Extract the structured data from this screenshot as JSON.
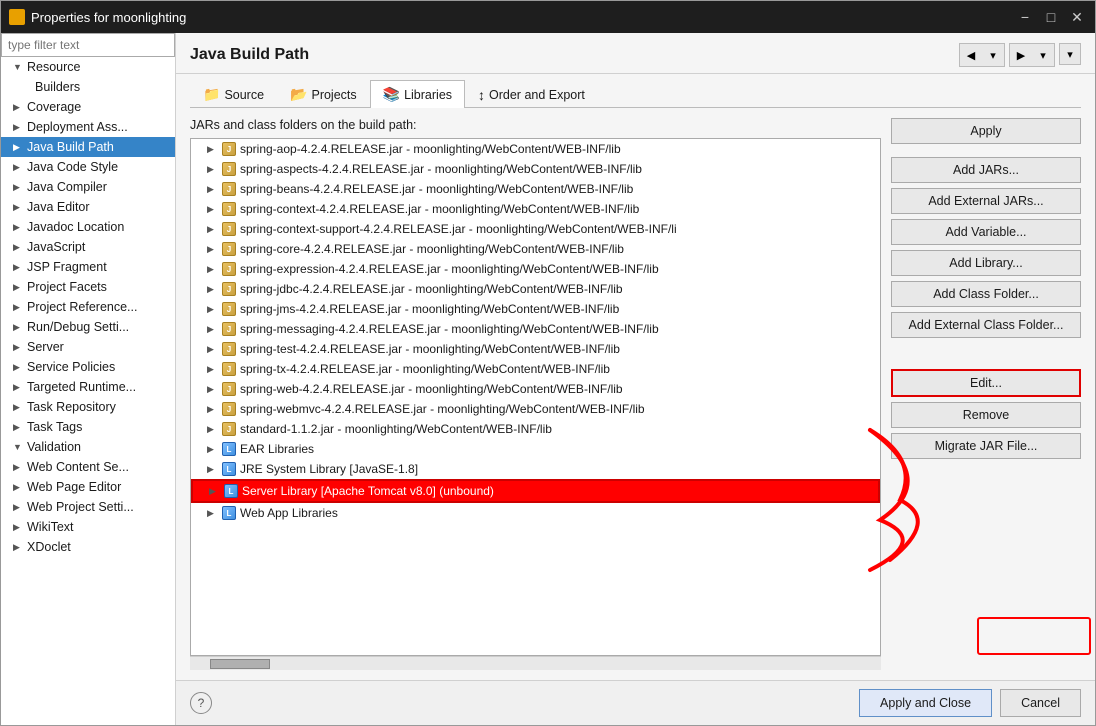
{
  "window": {
    "title": "Properties for moonlighting",
    "icon": "eclipse-icon"
  },
  "titlebar_buttons": {
    "minimize": "−",
    "maximize": "□",
    "close": "✕"
  },
  "filter": {
    "placeholder": "type filter text"
  },
  "sidebar": {
    "items": [
      {
        "label": "Resource",
        "expanded": true,
        "indent": 1,
        "selected": false
      },
      {
        "label": "Builders",
        "expanded": false,
        "indent": 2,
        "selected": false
      },
      {
        "label": "Coverage",
        "expanded": false,
        "indent": 1,
        "selected": false
      },
      {
        "label": "Deployment Ass...",
        "expanded": false,
        "indent": 1,
        "selected": false
      },
      {
        "label": "Java Build Path",
        "expanded": false,
        "indent": 1,
        "selected": true
      },
      {
        "label": "Java Code Style",
        "expanded": false,
        "indent": 1,
        "selected": false
      },
      {
        "label": "Java Compiler",
        "expanded": false,
        "indent": 1,
        "selected": false
      },
      {
        "label": "Java Editor",
        "expanded": false,
        "indent": 1,
        "selected": false
      },
      {
        "label": "Javadoc Location",
        "expanded": false,
        "indent": 1,
        "selected": false
      },
      {
        "label": "JavaScript",
        "expanded": false,
        "indent": 1,
        "selected": false
      },
      {
        "label": "JSP Fragment",
        "expanded": false,
        "indent": 1,
        "selected": false
      },
      {
        "label": "Project Facets",
        "expanded": false,
        "indent": 1,
        "selected": false
      },
      {
        "label": "Project Reference...",
        "expanded": false,
        "indent": 1,
        "selected": false
      },
      {
        "label": "Run/Debug Setti...",
        "expanded": false,
        "indent": 1,
        "selected": false
      },
      {
        "label": "Server",
        "expanded": false,
        "indent": 1,
        "selected": false
      },
      {
        "label": "Service Policies",
        "expanded": false,
        "indent": 1,
        "selected": false
      },
      {
        "label": "Targeted Runtime...",
        "expanded": false,
        "indent": 1,
        "selected": false
      },
      {
        "label": "Task Repository",
        "expanded": false,
        "indent": 1,
        "selected": false
      },
      {
        "label": "Task Tags",
        "expanded": false,
        "indent": 1,
        "selected": false
      },
      {
        "label": "Validation",
        "expanded": true,
        "indent": 1,
        "selected": false
      },
      {
        "label": "Web Content Se...",
        "expanded": false,
        "indent": 1,
        "selected": false
      },
      {
        "label": "Web Page Editor",
        "expanded": false,
        "indent": 1,
        "selected": false
      },
      {
        "label": "Web Project Setti...",
        "expanded": false,
        "indent": 1,
        "selected": false
      },
      {
        "label": "WikiText",
        "expanded": false,
        "indent": 1,
        "selected": false
      },
      {
        "label": "XDoclet",
        "expanded": false,
        "indent": 1,
        "selected": false
      }
    ]
  },
  "panel": {
    "title": "Java Build Path"
  },
  "tabs": [
    {
      "label": "Source",
      "icon": "📁",
      "active": false
    },
    {
      "label": "Projects",
      "icon": "📂",
      "active": false
    },
    {
      "label": "Libraries",
      "icon": "📚",
      "active": true
    },
    {
      "label": "Order and Export",
      "icon": "↕",
      "active": false
    }
  ],
  "tree": {
    "label": "JARs and class folders on the build path:",
    "items": [
      {
        "text": "spring-aop-4.2.4.RELEASE.jar - moonlighting/WebContent/WEB-INF/lib",
        "type": "jar",
        "indent": 1,
        "highlighted": false
      },
      {
        "text": "spring-aspects-4.2.4.RELEASE.jar - moonlighting/WebContent/WEB-INF/lib",
        "type": "jar",
        "indent": 1,
        "highlighted": false
      },
      {
        "text": "spring-beans-4.2.4.RELEASE.jar - moonlighting/WebContent/WEB-INF/lib",
        "type": "jar",
        "indent": 1,
        "highlighted": false
      },
      {
        "text": "spring-context-4.2.4.RELEASE.jar - moonlighting/WebContent/WEB-INF/lib",
        "type": "jar",
        "indent": 1,
        "highlighted": false
      },
      {
        "text": "spring-context-support-4.2.4.RELEASE.jar - moonlighting/WebContent/WEB-INF/li",
        "type": "jar",
        "indent": 1,
        "highlighted": false
      },
      {
        "text": "spring-core-4.2.4.RELEASE.jar - moonlighting/WebContent/WEB-INF/lib",
        "type": "jar",
        "indent": 1,
        "highlighted": false
      },
      {
        "text": "spring-expression-4.2.4.RELEASE.jar - moonlighting/WebContent/WEB-INF/lib",
        "type": "jar",
        "indent": 1,
        "highlighted": false
      },
      {
        "text": "spring-jdbc-4.2.4.RELEASE.jar - moonlighting/WebContent/WEB-INF/lib",
        "type": "jar",
        "indent": 1,
        "highlighted": false
      },
      {
        "text": "spring-jms-4.2.4.RELEASE.jar - moonlighting/WebContent/WEB-INF/lib",
        "type": "jar",
        "indent": 1,
        "highlighted": false
      },
      {
        "text": "spring-messaging-4.2.4.RELEASE.jar - moonlighting/WebContent/WEB-INF/lib",
        "type": "jar",
        "indent": 1,
        "highlighted": false
      },
      {
        "text": "spring-test-4.2.4.RELEASE.jar - moonlighting/WebContent/WEB-INF/lib",
        "type": "jar",
        "indent": 1,
        "highlighted": false
      },
      {
        "text": "spring-tx-4.2.4.RELEASE.jar - moonlighting/WebContent/WEB-INF/lib",
        "type": "jar",
        "indent": 1,
        "highlighted": false
      },
      {
        "text": "spring-web-4.2.4.RELEASE.jar - moonlighting/WebContent/WEB-INF/lib",
        "type": "jar",
        "indent": 1,
        "highlighted": false
      },
      {
        "text": "spring-webmvc-4.2.4.RELEASE.jar - moonlighting/WebContent/WEB-INF/lib",
        "type": "jar",
        "indent": 1,
        "highlighted": false
      },
      {
        "text": "standard-1.1.2.jar - moonlighting/WebContent/WEB-INF/lib",
        "type": "jar",
        "indent": 1,
        "highlighted": false
      },
      {
        "text": "EAR Libraries",
        "type": "lib",
        "indent": 1,
        "highlighted": false
      },
      {
        "text": "JRE System Library [JavaSE-1.8]",
        "type": "lib",
        "indent": 1,
        "highlighted": false
      },
      {
        "text": "Server Library [Apache Tomcat v8.0] (unbound)",
        "type": "lib",
        "indent": 1,
        "highlighted": true
      },
      {
        "text": "Web App Libraries",
        "type": "lib",
        "indent": 1,
        "highlighted": false
      }
    ]
  },
  "buttons": [
    {
      "label": "Add JARs...",
      "focused": false
    },
    {
      "label": "Add External JARs...",
      "focused": false
    },
    {
      "label": "Add Variable...",
      "focused": false
    },
    {
      "label": "Add Library...",
      "focused": false
    },
    {
      "label": "Add Class Folder...",
      "focused": false
    },
    {
      "label": "Add External Class Folder...",
      "focused": false
    },
    {
      "label": "Edit...",
      "focused": true
    },
    {
      "label": "Remove",
      "focused": false
    },
    {
      "label": "Migrate JAR File...",
      "focused": false
    }
  ],
  "footer": {
    "apply_label": "Apply",
    "apply_close_label": "Apply and Close",
    "cancel_label": "Cancel"
  }
}
